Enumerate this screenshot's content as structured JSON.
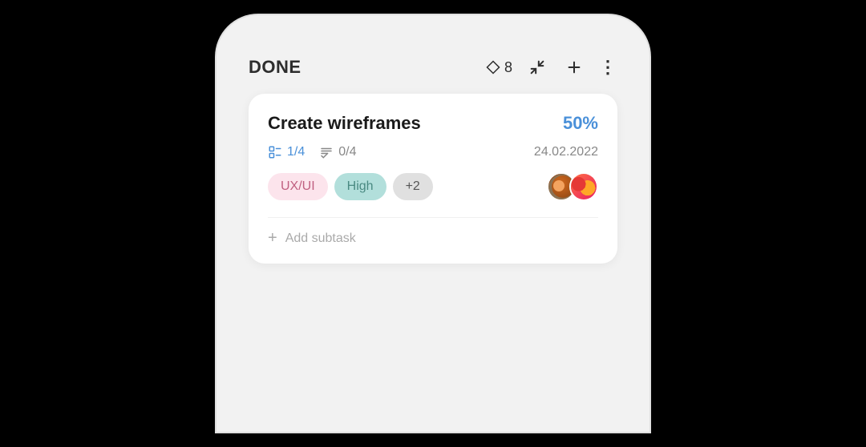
{
  "column": {
    "title": "DONE",
    "story_points": "8"
  },
  "task": {
    "title": "Create wireframes",
    "progress": "50%",
    "subtasks": "1/4",
    "checklist": "0/4",
    "date": "24.02.2022",
    "tags": [
      "UX/UI",
      "High",
      "+2"
    ],
    "add_subtask_label": "Add subtask"
  },
  "icons": {
    "diamond": "◆",
    "compress": "compress",
    "add": "+",
    "more": "⋮",
    "subtask": "⊏",
    "checklist": "≔"
  },
  "colors": {
    "accent_blue": "#4a90d9",
    "tag_uxui_bg": "#fce4ec",
    "tag_uxui_text": "#c06080",
    "tag_high_bg": "#b2dfdb",
    "tag_high_text": "#4a8a82",
    "tag_more_bg": "#e0e0e0",
    "tag_more_text": "#555555"
  }
}
